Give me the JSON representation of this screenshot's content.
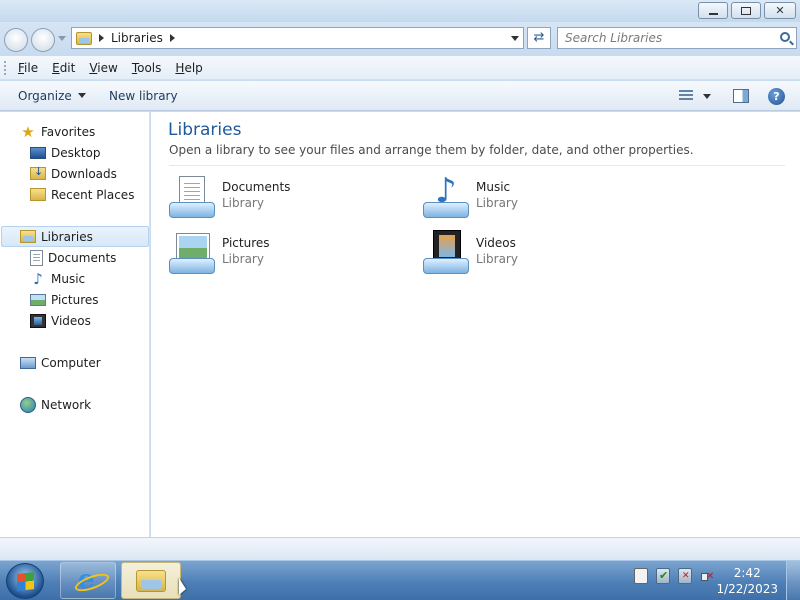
{
  "window": {
    "buttons": {
      "minimize": "minimize",
      "restore": "restore",
      "close": "close"
    }
  },
  "address": {
    "location": "Libraries",
    "search_placeholder": "Search Libraries"
  },
  "menu": {
    "items": [
      {
        "label": "File",
        "underline": "F",
        "rest": "ile"
      },
      {
        "label": "Edit",
        "underline": "E",
        "rest": "dit"
      },
      {
        "label": "View",
        "underline": "V",
        "rest": "iew"
      },
      {
        "label": "Tools",
        "underline": "T",
        "rest": "ools"
      },
      {
        "label": "Help",
        "underline": "H",
        "rest": "elp"
      }
    ]
  },
  "commands": {
    "organize": "Organize",
    "new_library": "New library"
  },
  "nav": {
    "favorites": {
      "label": "Favorites",
      "icon": "star-icon"
    },
    "favorites_items": [
      {
        "label": "Desktop",
        "icon": "desktop-icon"
      },
      {
        "label": "Downloads",
        "icon": "downloads-folder-icon"
      },
      {
        "label": "Recent Places",
        "icon": "recent-places-icon"
      }
    ],
    "libraries": {
      "label": "Libraries",
      "icon": "libraries-icon",
      "selected": true
    },
    "libraries_items": [
      {
        "label": "Documents",
        "icon": "documents-icon"
      },
      {
        "label": "Music",
        "icon": "music-icon"
      },
      {
        "label": "Pictures",
        "icon": "pictures-icon"
      },
      {
        "label": "Videos",
        "icon": "videos-icon"
      }
    ],
    "computer": {
      "label": "Computer",
      "icon": "computer-icon"
    },
    "network": {
      "label": "Network",
      "icon": "network-icon"
    }
  },
  "main": {
    "title": "Libraries",
    "subtitle": "Open a library to see your files and arrange them by folder, date, and other properties.",
    "libraries": [
      {
        "name": "Documents",
        "kind": "Library",
        "icon": "documents-library-icon"
      },
      {
        "name": "Music",
        "kind": "Library",
        "icon": "music-library-icon"
      },
      {
        "name": "Pictures",
        "kind": "Library",
        "icon": "pictures-library-icon"
      },
      {
        "name": "Videos",
        "kind": "Library",
        "icon": "videos-library-icon"
      }
    ]
  },
  "taskbar": {
    "clock_time": "2:42",
    "clock_date": "1/22/2023"
  }
}
